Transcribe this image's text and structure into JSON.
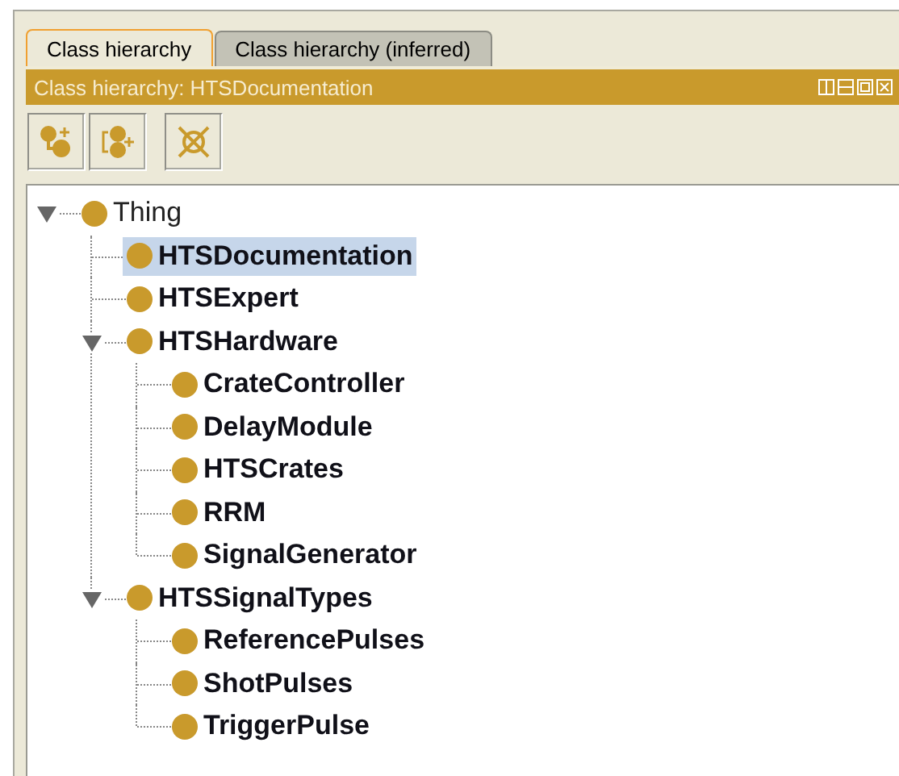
{
  "tabs": [
    {
      "label": "Class hierarchy",
      "selected": true
    },
    {
      "label": "Class hierarchy (inferred)",
      "selected": false
    }
  ],
  "view": {
    "title": "Class hierarchy: HTSDocumentation"
  },
  "tree": [
    {
      "label": "Thing",
      "selected": false,
      "expanded": true,
      "children": [
        {
          "label": "HTSDocumentation",
          "selected": true
        },
        {
          "label": "HTSExpert",
          "selected": false
        },
        {
          "label": "HTSHardware",
          "selected": false,
          "expanded": true,
          "children": [
            {
              "label": "CrateController",
              "selected": false
            },
            {
              "label": "DelayModule",
              "selected": false
            },
            {
              "label": "HTSCrates",
              "selected": false
            },
            {
              "label": "RRM",
              "selected": false
            },
            {
              "label": "SignalGenerator",
              "selected": false
            }
          ]
        },
        {
          "label": "HTSSignalTypes",
          "selected": false,
          "expanded": true,
          "children": [
            {
              "label": "ReferencePulses",
              "selected": false
            },
            {
              "label": "ShotPulses",
              "selected": false
            },
            {
              "label": "TriggerPulse",
              "selected": false
            }
          ]
        }
      ]
    }
  ]
}
